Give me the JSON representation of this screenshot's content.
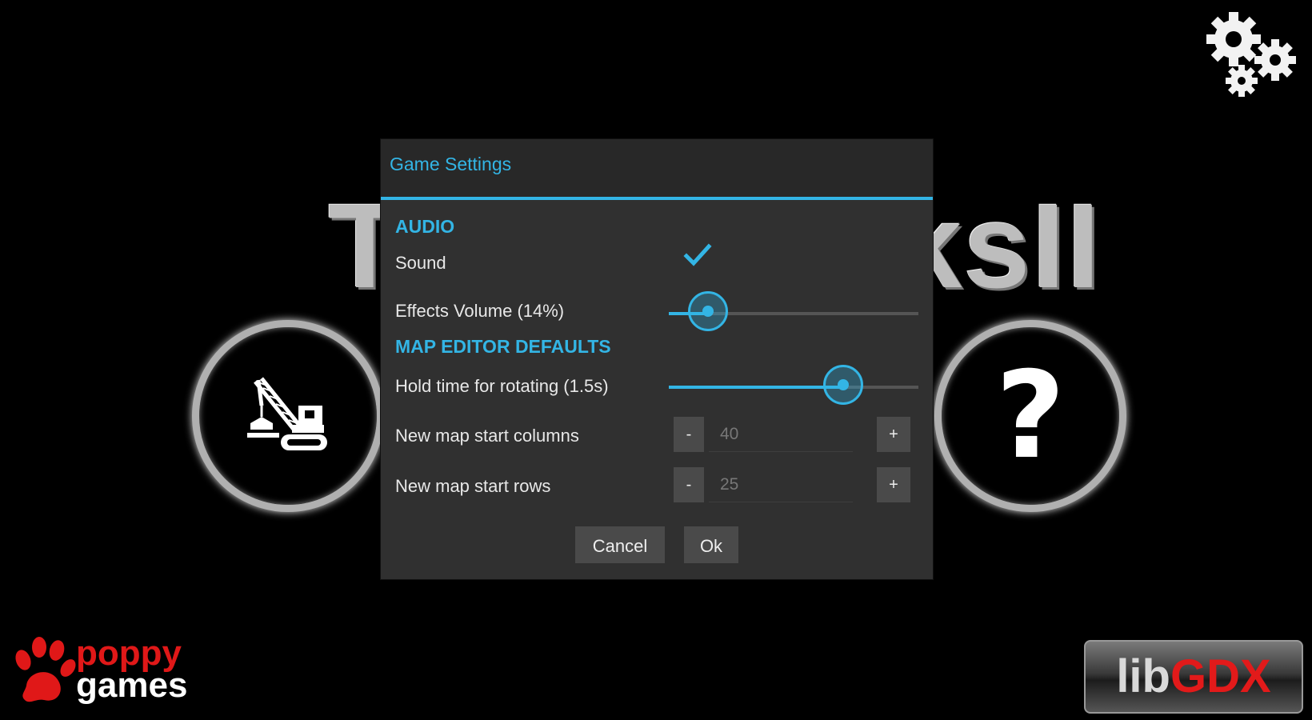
{
  "background": {
    "title_visible_left": "T",
    "title_visible_right": "ksII",
    "help_symbol": "?",
    "logos": {
      "poppy_top": "poppy",
      "poppy_bottom": "games",
      "libgdx_lib": "lib",
      "libgdx_gdx": "GDX"
    },
    "icons": [
      "crane-icon",
      "help-icon",
      "settings-gears-icon"
    ]
  },
  "dialog": {
    "title": "Game Settings",
    "sections": {
      "audio": {
        "header": "AUDIO",
        "sound_label": "Sound",
        "sound_checked": true,
        "effects_label": "Effects Volume (14%)",
        "effects_value": 0.14
      },
      "map_editor": {
        "header": "MAP EDITOR DEFAULTS",
        "hold_label": "Hold time for rotating (1.5s)",
        "hold_value": 0.7,
        "columns_label": "New map start columns",
        "columns_value": "40",
        "rows_label": "New map start rows",
        "rows_value": "25",
        "minus": "-",
        "plus": "+"
      }
    },
    "cancel_label": "Cancel",
    "ok_label": "Ok"
  },
  "colors": {
    "accent": "#33b5e5",
    "dialog_bg": "#303030",
    "poppy_red": "#e01818",
    "gdx_red": "#e21a1a"
  }
}
